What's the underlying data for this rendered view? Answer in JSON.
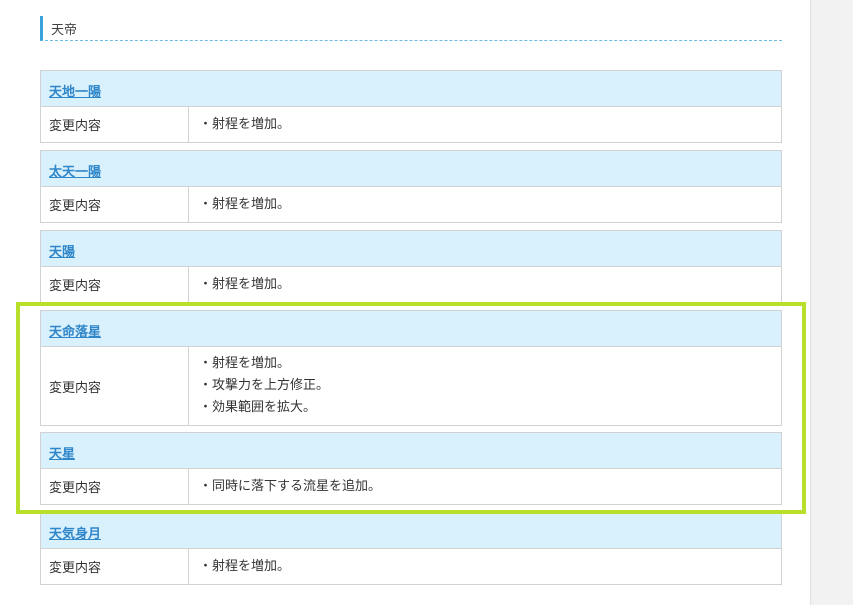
{
  "section": {
    "title": "天帝"
  },
  "row_label": "変更内容",
  "skills": [
    {
      "name": "天地一陽",
      "changes": [
        "・射程を増加。"
      ]
    },
    {
      "name": "太天一陽",
      "changes": [
        "・射程を増加。"
      ]
    },
    {
      "name": "天陽",
      "changes": [
        "・射程を増加。"
      ]
    },
    {
      "name": "天命落星",
      "changes": [
        "・射程を増加。",
        "・攻撃力を上方修正。",
        "・効果範囲を拡大。"
      ]
    },
    {
      "name": "天星",
      "changes": [
        "・同時に落下する流星を追加。"
      ]
    },
    {
      "name": "天気身月",
      "changes": [
        "・射程を増加。"
      ]
    }
  ],
  "colors": {
    "header_bg": "#d9f0fd",
    "link": "#2f86c8",
    "highlight": "#b8e02a",
    "accent": "#3aa3db"
  }
}
